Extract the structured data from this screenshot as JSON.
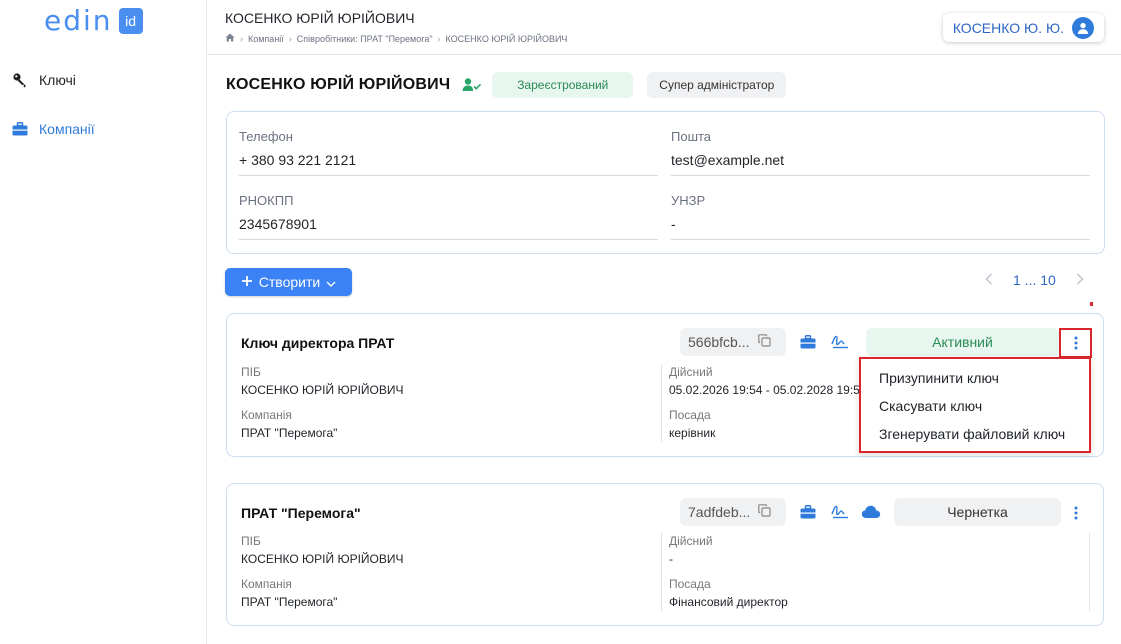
{
  "logo": {
    "text": "edin",
    "badge": "id"
  },
  "sidebar": {
    "items": [
      {
        "label": "Ключі",
        "icon": "key-icon"
      },
      {
        "label": "Компанії",
        "icon": "briefcase-icon"
      }
    ]
  },
  "header": {
    "title": "КОСЕНКО ЮРІЙ ЮРІЙОВИЧ",
    "breadcrumb": [
      "Компанії",
      "Співробітники: ПРАТ \"Перемога\"",
      "КОСЕНКО ЮРІЙ ЮРІЙОВИЧ"
    ],
    "user_button": "КОСЕНКО Ю. Ю."
  },
  "profile": {
    "name": "КОСЕНКО ЮРІЙ ЮРІЙОВИЧ",
    "status_badge": "Зареєстрований",
    "role_badge": "Супер адміністратор",
    "fields": {
      "phone_label": "Телефон",
      "phone_value": "+ 380 93 221 2121",
      "email_label": "Пошта",
      "email_value": "test@example.net",
      "rnokpp_label": "РНОКПП",
      "rnokpp_value": "2345678901",
      "unzr_label": "УНЗР",
      "unzr_value": "-"
    }
  },
  "toolbar": {
    "create_label": "Створити",
    "pagination": "1 ... 10"
  },
  "keys": [
    {
      "name": "Ключ директора ПРАТ",
      "id_short": "566bfcb...",
      "status": "Активний",
      "pib_label": "ПІБ",
      "pib_value": "КОСЕНКО ЮРІЙ ЮРІЙОВИЧ",
      "valid_label": "Дійсний",
      "valid_value": "05.02.2026 19:54 - 05.02.2028 19:54",
      "company_label": "Компанія",
      "company_value": "ПРАТ \"Перемога\"",
      "position_label": "Посада",
      "position_value": "керівник"
    },
    {
      "name": "ПРАТ \"Перемога\"",
      "id_short": "7adfdeb...",
      "status": "Чернетка",
      "pib_label": "ПІБ",
      "pib_value": "КОСЕНКО ЮРІЙ ЮРІЙОВИЧ",
      "valid_label": "Дійсний",
      "valid_value": "-",
      "company_label": "Компанія",
      "company_value": "ПРАТ \"Перемога\"",
      "position_label": "Посада",
      "position_value": "Фінансовий директор"
    }
  ],
  "context_menu": {
    "items": [
      "Призупинити ключ",
      "Скасувати ключ",
      "Згенерувати файловий ключ"
    ]
  },
  "colors": {
    "accent": "#3b82f6",
    "active_bg": "#e7f6ee",
    "active_text": "#2b8a57",
    "highlight": "#d9262c"
  }
}
